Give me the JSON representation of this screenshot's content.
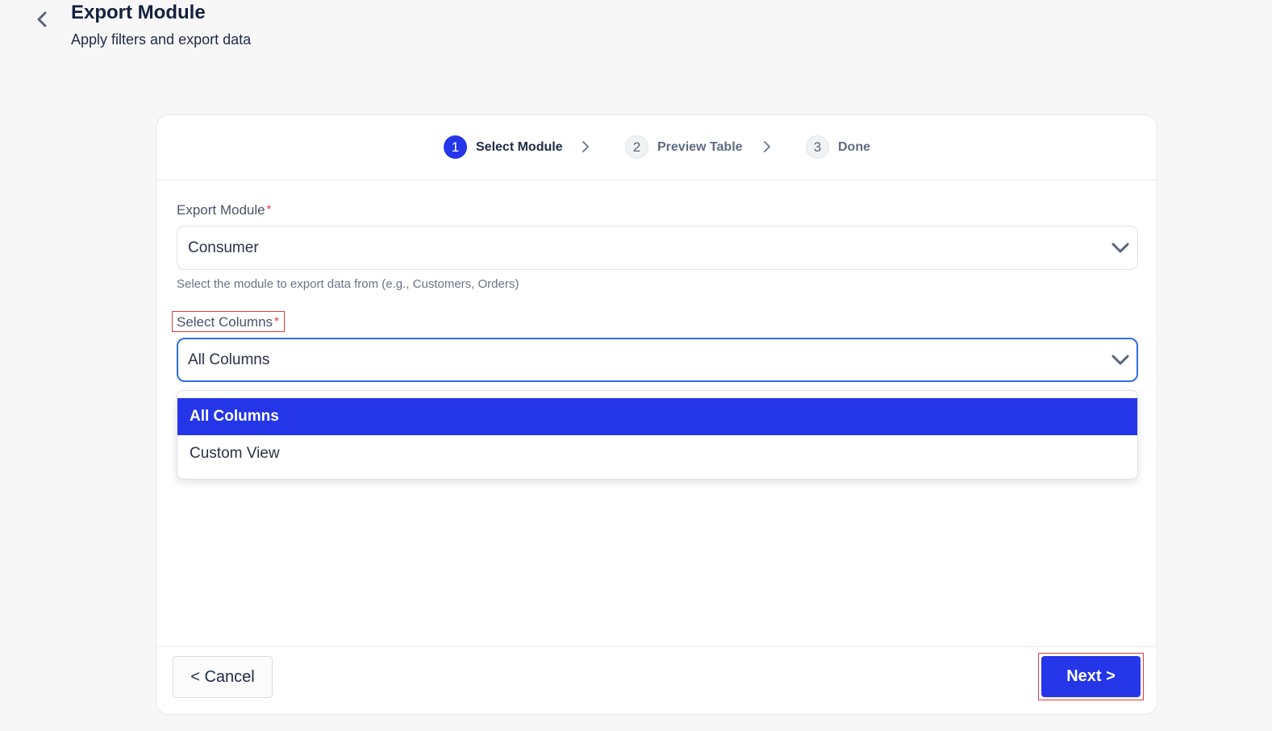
{
  "header": {
    "back_icon": "chevron-left-icon",
    "title": "Export Module",
    "subtitle": "Apply filters and export data"
  },
  "stepper": {
    "steps": [
      {
        "number": "1",
        "label": "Select Module",
        "state": "active"
      },
      {
        "number": "2",
        "label": "Preview Table",
        "state": "inactive"
      },
      {
        "number": "3",
        "label": "Done",
        "state": "inactive"
      }
    ],
    "separator_icon": "chevron-right-icon"
  },
  "form": {
    "export_module": {
      "label": "Export Module",
      "required_mark": "*",
      "value": "Consumer",
      "helper": "Select the module to export data from (e.g., Customers, Orders)"
    },
    "select_columns": {
      "label": "Select Columns",
      "required_mark": "*",
      "value": "All Columns",
      "options": [
        "All Columns",
        "Custom View"
      ],
      "selected_index": 0
    }
  },
  "footer": {
    "cancel_label": "< Cancel",
    "next_label": "Next >"
  },
  "colors": {
    "primary": "#2536e8",
    "focus_border": "#2f6fe0",
    "required": "#e5252a",
    "highlight_box": "#e23b3b"
  }
}
